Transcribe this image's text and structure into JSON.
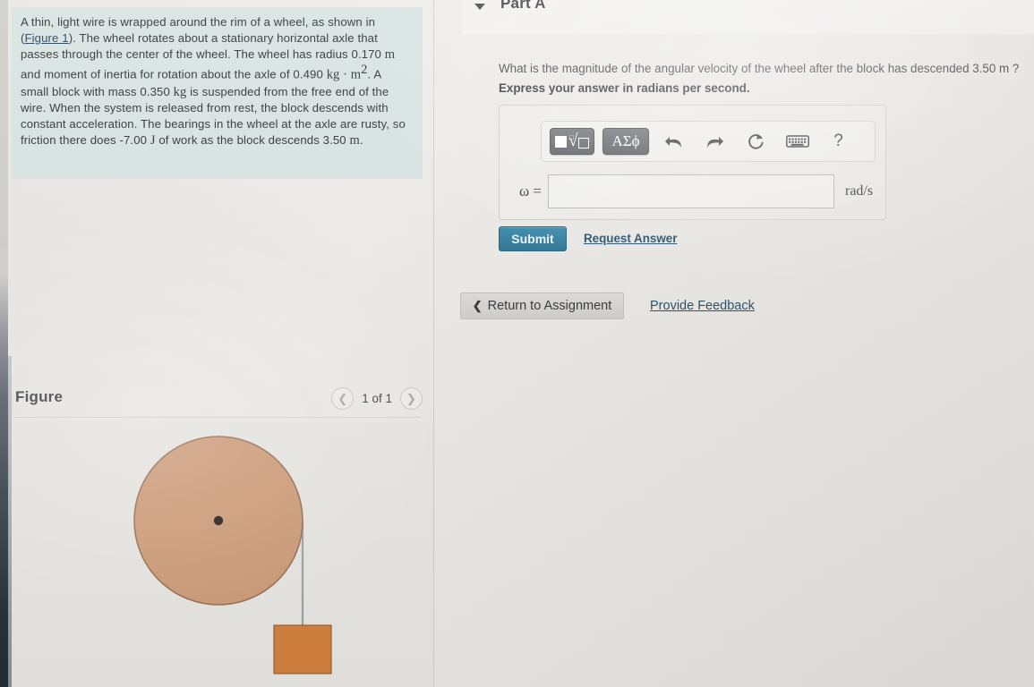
{
  "problem": {
    "text_before_link": "A thin, light wire is wrapped around the rim of a wheel, as shown in (",
    "figure_link": "Figure 1",
    "full_text": "A thin, light wire is wrapped around the rim of a wheel, as shown in (Figure 1). The wheel rotates about a stationary horizontal axle that passes through the center of the wheel. The wheel has radius 0.170 m and moment of inertia for rotation about the axle of 0.490 kg · m2 . A small block with mass 0.350 kg is suspended from the free end of the wire. When the system is released from rest, the block descends with constant acceleration. The bearings in the wheel at the axle are rusty, so friction there does -7.00 J of work as the block descends 3.50 m.",
    "seg1": "). The wheel rotates about a stationary horizontal axle that passes through the center of the wheel. The wheel has radius ",
    "radius_value": "0.170",
    "radius_unit": "m",
    "seg2": " and moment of inertia for rotation about the axle of ",
    "inertia_value": "0.490",
    "inertia_unit": "kg · m",
    "inertia_exp": "2",
    "seg3": ". A small block with mass ",
    "mass_value": "0.350",
    "mass_unit": "kg",
    "seg4": " is suspended from the free end of the wire. When the system is released from rest, the block descends with constant acceleration. The bearings in the wheel at the axle are rusty, so friction there does ",
    "friction_value": "-7.00",
    "friction_unit": "J",
    "seg5": " of work as the block descends ",
    "descent_value": "3.50",
    "descent_unit": "m",
    "seg6": "."
  },
  "figure": {
    "title": "Figure",
    "pager_label": "1 of 1",
    "prev_icon": "chevron-left-icon",
    "next_icon": "chevron-right-icon",
    "wheel_fill": "#cf9b76",
    "wheel_stroke": "#9a6f52",
    "block_fill": "#d4823f",
    "block_stroke": "#a9653080",
    "wire_color": "#9aa3a6",
    "axle_color": "#221a14"
  },
  "part": {
    "caret_icon": "caret-down-icon",
    "title": "Part A",
    "question": "What is the magnitude of the angular velocity of the wheel after the block has descended 3.50 m ?",
    "instruction": "Express your answer in radians per second."
  },
  "mathbar": {
    "template_button": {
      "name": "math-template-button",
      "label": "√"
    },
    "greek_button_label": "ΑΣϕ",
    "undo_icon": "undo-arrow-icon",
    "redo_icon": "redo-arrow-icon",
    "reset_icon": "reset-circular-arrow-icon",
    "keyboard_icon": "keyboard-icon",
    "help_icon": "question-mark-icon",
    "help_label": "?"
  },
  "answer": {
    "variable_label": "ω =",
    "value": "",
    "placeholder": "",
    "unit": "rad/s"
  },
  "actions": {
    "submit_label": "Submit",
    "request_answer_label": "Request Answer",
    "return_label": "Return to Assignment",
    "return_icon": "chevron-left-icon",
    "feedback_label": "Provide Feedback"
  },
  "colors": {
    "submit_blue": "#2a7ba0",
    "link_blue": "#1d4a66",
    "highlight_box": "#d7e3e2",
    "page_bg": "#eceae6"
  }
}
